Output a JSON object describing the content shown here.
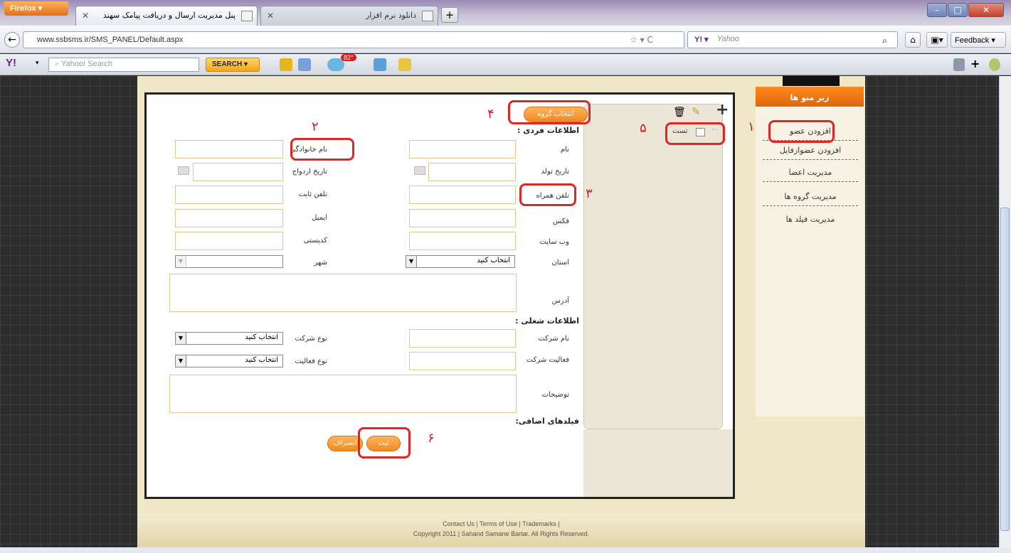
{
  "browser": {
    "app_button": "Firefox",
    "tabs": [
      {
        "title": "پنل مدیریت ارسال و دریافت پیامک سهند",
        "active": true
      },
      {
        "title": "دانلود نرم افزار",
        "active": false
      }
    ],
    "url": "www.ssbsms.ir/SMS_PANEL/Default.aspx",
    "search_engine": "Yahoo",
    "feedback_label": "Feedback"
  },
  "yahoo_toolbar": {
    "logo": "Y!",
    "search_placeholder": "Yahoo! Search",
    "search_button": "SEARCH",
    "weather_temp": "82°"
  },
  "sidebar": {
    "header": "زیر منو ها",
    "items": [
      {
        "label": "افزودن عضو"
      },
      {
        "label": "افزودن عضوازفایل"
      },
      {
        "label": "مدیریت اعضا"
      },
      {
        "label": "مدیریت گروه ها"
      },
      {
        "label": "مدیریت فیلد ها"
      }
    ]
  },
  "tree": {
    "node_label": "تست"
  },
  "form": {
    "select_group_button": "انتخاب گروه",
    "section_personal": "اطلاعات فردی :",
    "section_job": "اطلاعات شغلی :",
    "section_extra": "فیلدهای اضافی:",
    "first_name": "نام",
    "last_name": "نام خانوادگی",
    "birth_date": "تاریخ تولد",
    "marriage_date": "تاریخ ازدواج",
    "mobile": "تلفن همراه",
    "phone": "تلفن ثابت",
    "fax": "فکس",
    "email": "ایمیل",
    "website": "وب سایت",
    "postal_code": "کدپستی",
    "province": "استان",
    "city": "شهر",
    "address": "آدرس",
    "company_name": "نام شرکت",
    "company_type": "نوع شرکت",
    "company_activity": "فعالیت شرکت",
    "activity_type": "نوع فعالیت",
    "description": "توضیحات",
    "select_placeholder": "انتخاب کنید",
    "submit_button": "ثبت",
    "cancel_button": "انصراف"
  },
  "annotations": [
    "۱",
    "۲",
    "۳",
    "۴",
    "۵",
    "۶"
  ],
  "footer": {
    "links": "Contact Us | Terms of Use | Trademarks |",
    "copyright": "Copyright 2011 | Sahand Samane Bartar. All Rights Reserved."
  },
  "colors": {
    "accent_orange": "#f08a22",
    "annotation_red": "#e02525",
    "page_bg": "#efe7c6"
  }
}
